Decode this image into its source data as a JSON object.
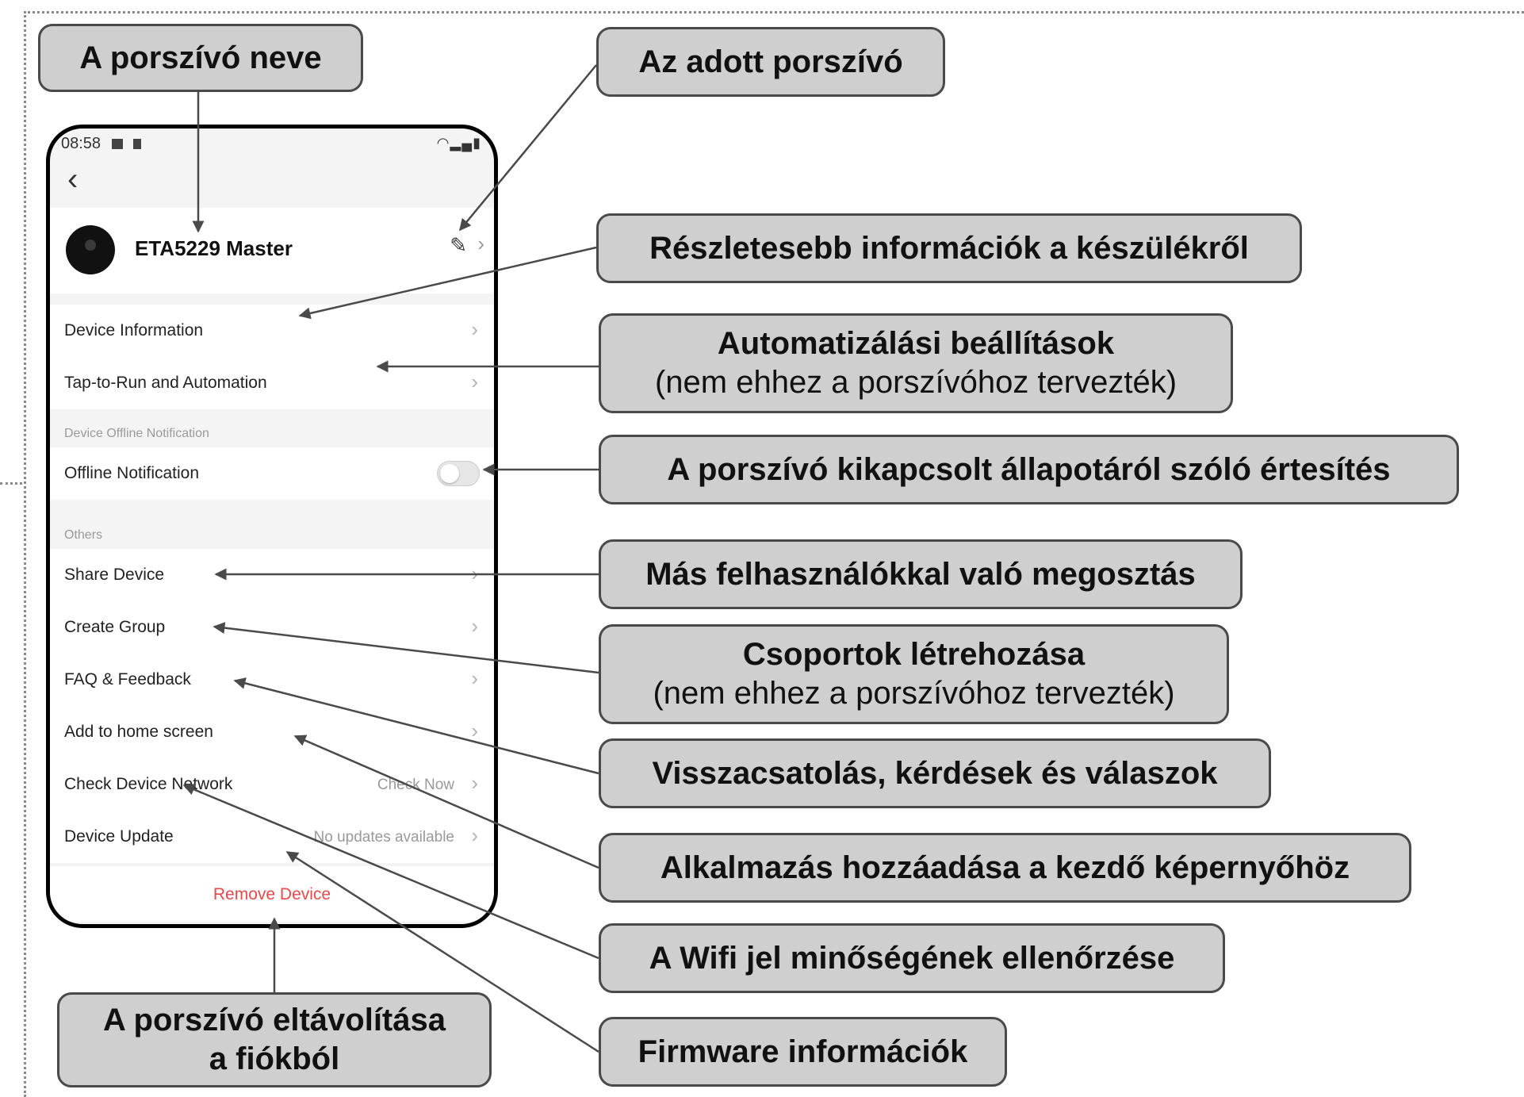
{
  "phone": {
    "status_time": "08:58",
    "device_name": "ETA5229 Master",
    "rows": {
      "device_information": "Device Information",
      "tap_to_run": "Tap-to-Run and Automation",
      "offline_section": "Device Offline Notification",
      "offline_notification": "Offline Notification",
      "others_section": "Others",
      "share_device": "Share Device",
      "create_group": "Create Group",
      "faq_feedback": "FAQ & Feedback",
      "add_home_screen": "Add to home screen",
      "check_network": "Check Device Network",
      "check_now": "Check Now",
      "device_update": "Device Update",
      "no_updates": "No updates available",
      "remove_device": "Remove Device"
    },
    "offline_toggle_on": false
  },
  "callouts": {
    "name": "A porszívó neve",
    "edit": "Az adott porszívó",
    "info": "Részletesebb információk a készülékről",
    "automation_title": "Automatizálási beállítások",
    "automation_sub": "(nem ehhez a porszívóhoz tervezték)",
    "offline": "A porszívó kikapcsolt állapotáról szóló értesítés",
    "share": "Más felhasználókkal való megosztás",
    "group_title": "Csoportok létrehozása",
    "group_sub": "(nem ehhez a porszívóhoz tervezték)",
    "feedback": "Visszacsatolás, kérdések és válaszok",
    "home": "Alkalmazás hozzáadása a kezdő képernyőhöz",
    "wifi": "A Wifi jel minőségének ellenőrzése",
    "firmware": "Firmware információk",
    "remove_line1": "A porszívó eltávolítása",
    "remove_line2": "a fiókból"
  },
  "colors": {
    "callout_bg": "#cfcfcf",
    "remove_red": "#e84a4a",
    "arrow": "#4a4a4a"
  }
}
